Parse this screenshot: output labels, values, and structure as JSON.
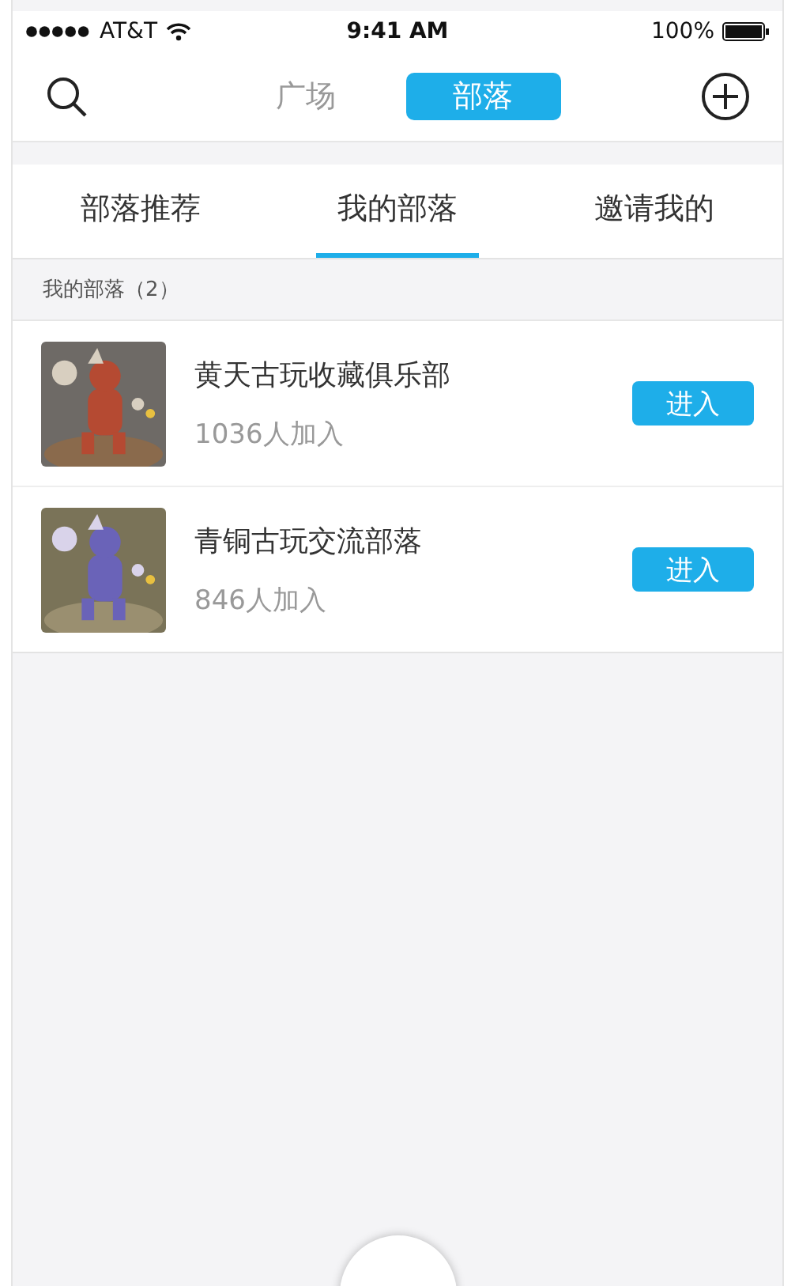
{
  "status_bar": {
    "carrier": "AT&T",
    "time": "9:41 AM",
    "battery": "100%"
  },
  "nav": {
    "segments": [
      {
        "label": "广场",
        "selected": false
      },
      {
        "label": "部落",
        "selected": true
      }
    ]
  },
  "tabs": [
    {
      "label": "部落推荐",
      "selected": false
    },
    {
      "label": "我的部落",
      "selected": true
    },
    {
      "label": "邀请我的",
      "selected": false
    }
  ],
  "section_header": "我的部落（2）",
  "tribes": [
    {
      "kind": "picture",
      "name": "黄天古玩收藏俱乐部",
      "members": "1036人加入",
      "button": "进入"
    },
    {
      "kind": "picture",
      "name": "青铜古玩交流部落",
      "members": "846人加入",
      "button": "进入"
    }
  ]
}
